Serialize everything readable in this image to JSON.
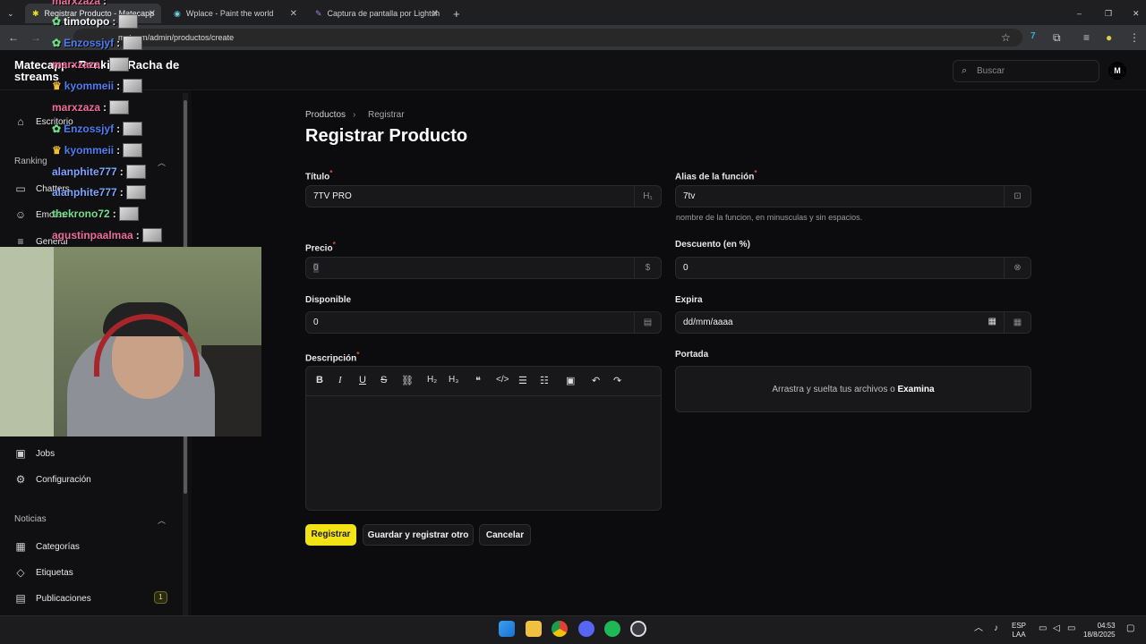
{
  "browser": {
    "tabs": [
      {
        "title": "Registrar Producto - Matecapp",
        "active": true
      },
      {
        "title": "Wplace - Paint the world",
        "active": false
      },
      {
        "title": "Captura de pantalla por Lightsh",
        "active": false
      }
    ],
    "url_visible": "mate",
    "url_path": "om/admin/productos/create"
  },
  "app": {
    "brand": "Matecapp - Ranking Racha de streams",
    "search_placeholder": "Buscar",
    "avatar_letter": "M"
  },
  "sidebar": {
    "items_top": [
      {
        "label": "Escritorio",
        "icon": "home-icon"
      }
    ],
    "group_ranking": "Ranking",
    "ranking_items": [
      {
        "label": "Chatters",
        "icon": "chat-icon"
      },
      {
        "label": "Emotes",
        "icon": "smile-icon"
      },
      {
        "label": "General",
        "icon": "list-icon"
      }
    ],
    "items_lower": [
      {
        "label": "Jobs",
        "icon": "cpu-icon"
      },
      {
        "label": "Configuración",
        "icon": "gear-icon"
      }
    ],
    "group_noticias": "Noticias",
    "noticias_items": [
      {
        "label": "Categorías",
        "icon": "grid-icon"
      },
      {
        "label": "Etiquetas",
        "icon": "tag-icon"
      },
      {
        "label": "Publicaciones",
        "icon": "doc-icon",
        "badge": "1"
      }
    ]
  },
  "breadcrumb": {
    "parent": "Productos",
    "current": "Registrar"
  },
  "page_title": "Registrar Producto",
  "form": {
    "titulo": {
      "label": "Título",
      "value": "7TV PRO"
    },
    "alias": {
      "label": "Alias de la función",
      "value": "7tv",
      "hint": "nombre de la funcion, en minusculas y sin espacios."
    },
    "precio": {
      "label": "Precio",
      "value": "0"
    },
    "descuento": {
      "label": "Descuento (en %)",
      "value": "0"
    },
    "disponible": {
      "label": "Disponible",
      "value": "0"
    },
    "expira": {
      "label": "Expira",
      "value": "dd/mm/aaaa"
    },
    "descripcion": {
      "label": "Descripción"
    },
    "portada": {
      "label": "Portada",
      "drop_text": "Arrastra y suelta tus archivos o",
      "drop_link": "Examina"
    }
  },
  "buttons": {
    "register": "Registrar",
    "register_another": "Guardar y registrar otro",
    "cancel": "Cancelar"
  },
  "chat_overlay": [
    {
      "user": "marxzaza",
      "color": "#f06a9a"
    },
    {
      "user": "timotopo",
      "color": "#ffffff"
    },
    {
      "user": "Enzossjyf",
      "color": "#4a7ef0"
    },
    {
      "user": "marxzaza",
      "color": "#f06a9a"
    },
    {
      "user": "kyommeii",
      "color": "#4a7ef0"
    },
    {
      "user": "marxzaza",
      "color": "#f06a9a"
    },
    {
      "user": "Enzossjyf",
      "color": "#4a7ef0"
    },
    {
      "user": "kyommeii",
      "color": "#4a7ef0"
    },
    {
      "user": "alanphite777",
      "color": "#7aa4ff"
    },
    {
      "user": "alanphite777",
      "color": "#7aa4ff"
    },
    {
      "user": "thekrono72",
      "color": "#6fe08a"
    },
    {
      "user": "agustinpaalmaa",
      "color": "#f06a9a"
    }
  ],
  "tray": {
    "lang": "ESP",
    "layout": "LAA",
    "time": "04:53",
    "date": "18/8/2025"
  }
}
